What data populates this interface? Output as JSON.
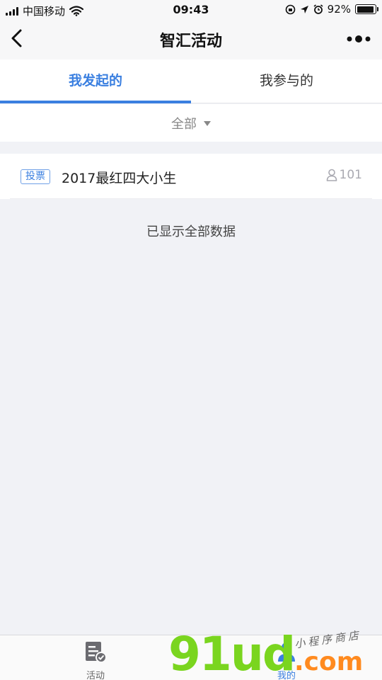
{
  "status_bar": {
    "carrier": "中国移动",
    "time": "09:43",
    "battery": "92%",
    "battery_level": 0.92
  },
  "nav": {
    "title": "智汇活动"
  },
  "tabs": [
    {
      "label": "我发起的",
      "active": true
    },
    {
      "label": "我参与的",
      "active": false
    }
  ],
  "filter": {
    "selected": "全部"
  },
  "list": [
    {
      "badge": "投票",
      "title": "2017最红四大小生",
      "count": "101"
    }
  ],
  "end_message": "已显示全部数据",
  "tabbar": {
    "activity_label": "活动",
    "mine_label": "我的"
  },
  "watermark": {
    "brand": "91ud",
    "tld": ".com",
    "tagline": "小程序商店"
  },
  "colors": {
    "accent": "#3a7fe0",
    "background": "#f1f2f6"
  }
}
